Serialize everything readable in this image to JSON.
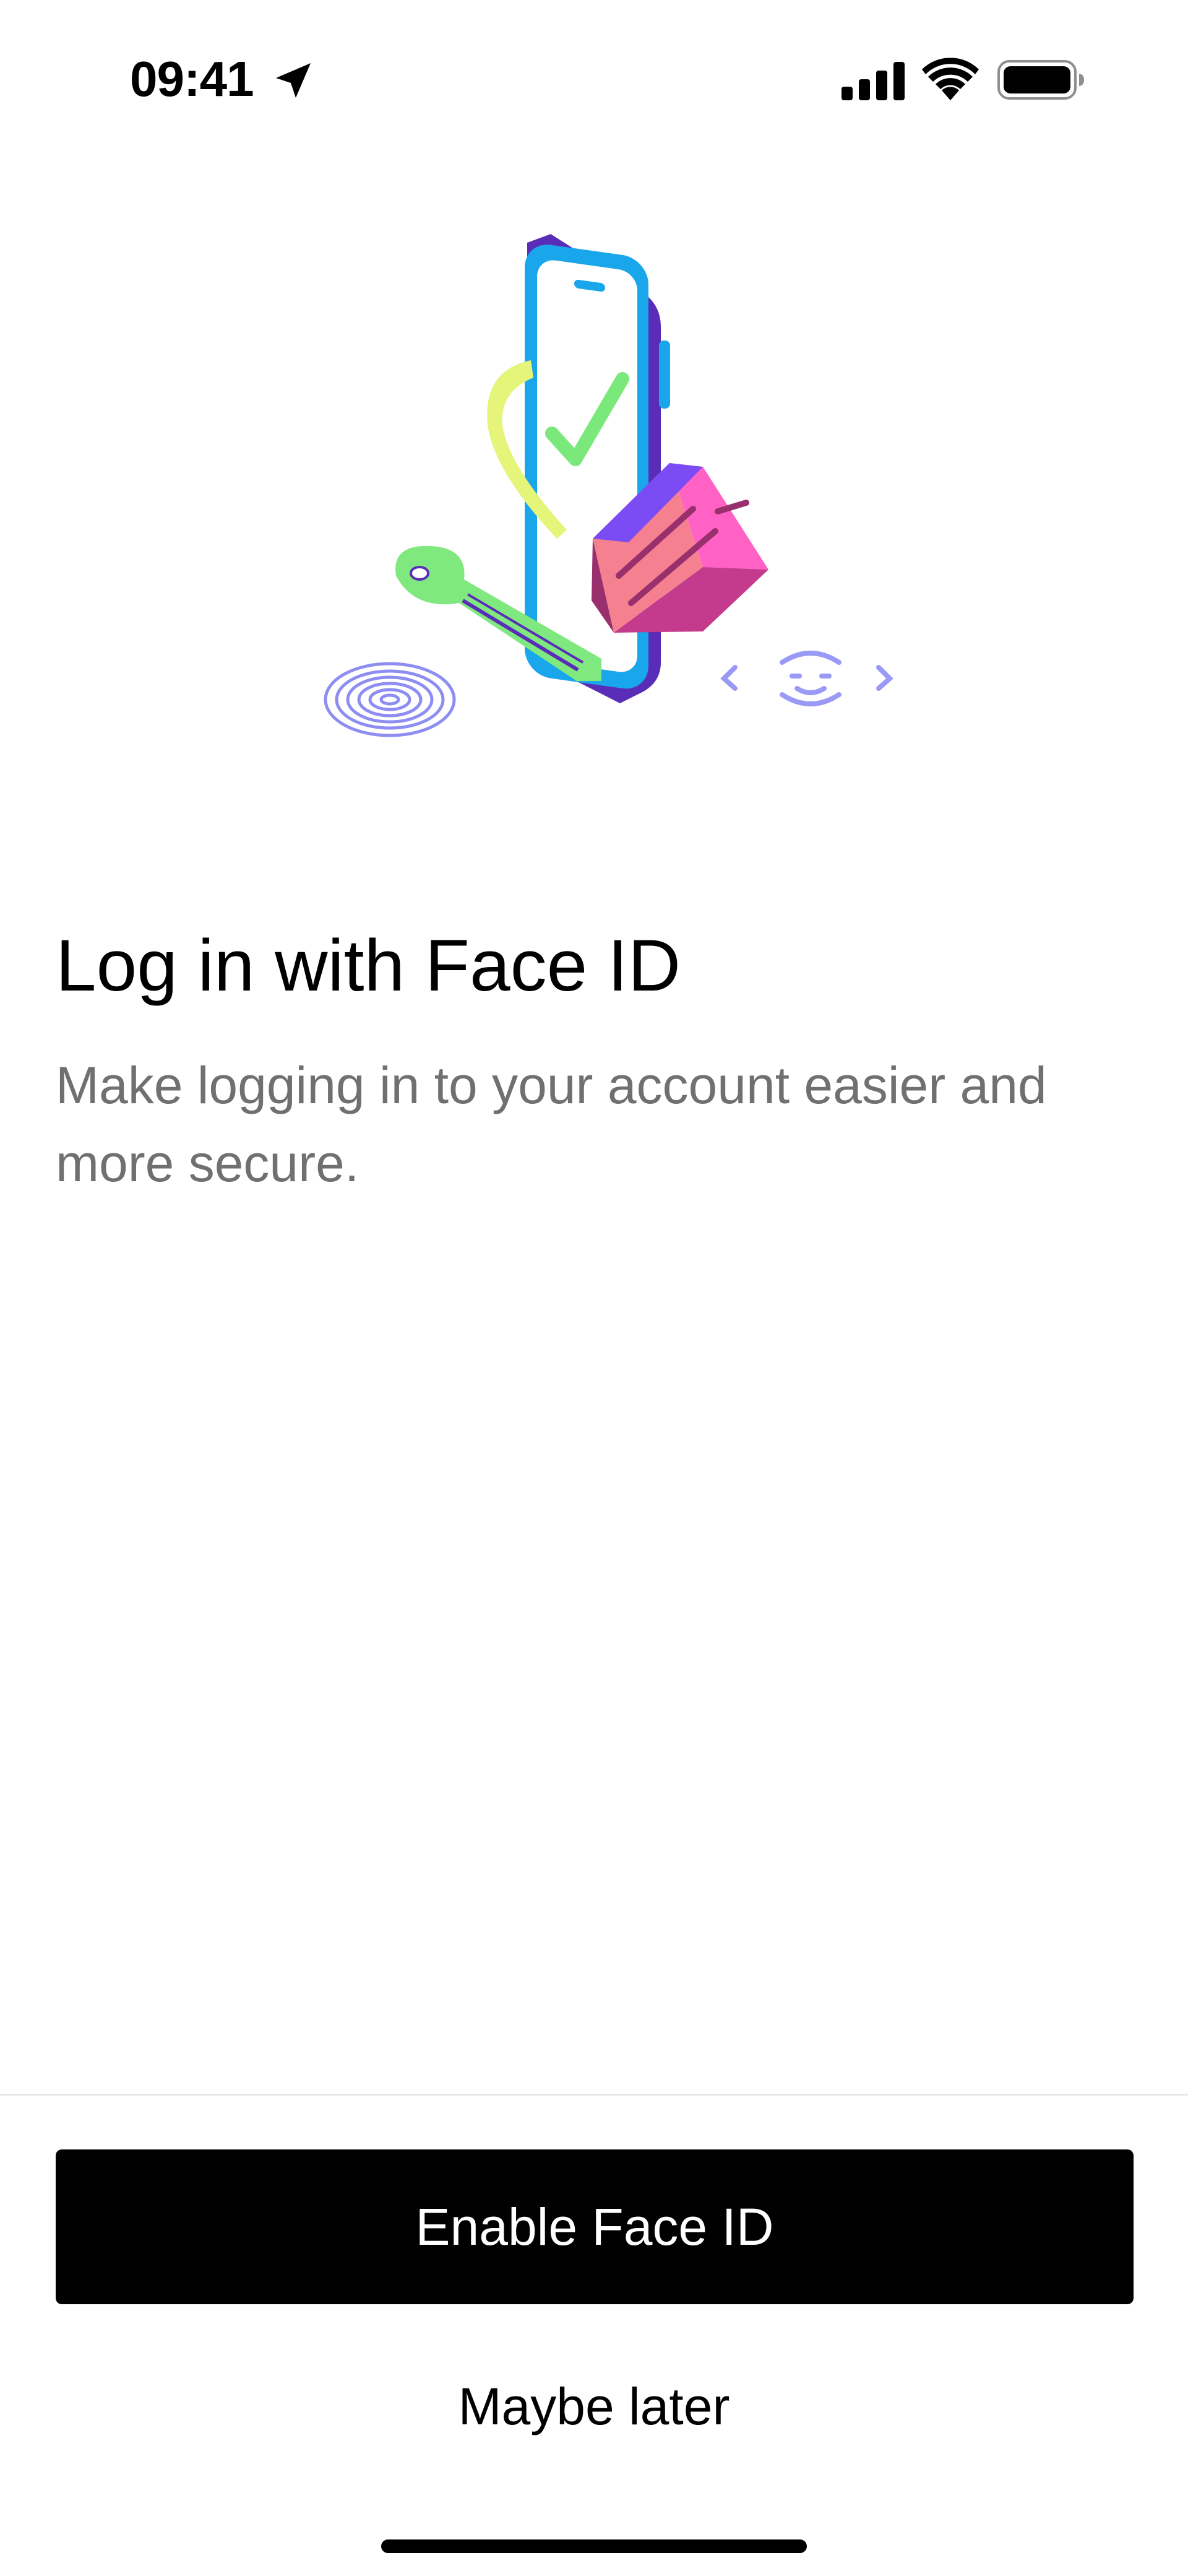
{
  "status_bar": {
    "time": "09:41",
    "icons": [
      "location-arrow-icon",
      "cellular-signal-icon",
      "wifi-icon",
      "battery-icon"
    ]
  },
  "illustration": {
    "icons": [
      "phone-icon",
      "checkmark-icon",
      "padlock-icon",
      "key-icon",
      "fingerprint-icon",
      "face-id-icon"
    ],
    "colors": {
      "phone_frame": "#1aa6ea",
      "phone_back": "#5a2db8",
      "check": "#7ae87a",
      "shackle": "#e4f57a",
      "lock_front": "#f5808f",
      "lock_side": "#ff62c4",
      "lock_top": "#7b4bf4",
      "key": "#7fe87f",
      "fingerprint": "#8d8df2",
      "face_id": "#9a9af6"
    }
  },
  "main": {
    "title": "Log in with Face ID",
    "subtitle": "Make logging in to your account easier and more secure."
  },
  "footer": {
    "primary_label": "Enable Face ID",
    "secondary_label": "Maybe later"
  },
  "colors": {
    "background": "#ffffff",
    "primary_button": "#000000",
    "primary_button_text": "#ffffff",
    "subtitle_text": "#707070",
    "divider": "#e6e6e6"
  }
}
